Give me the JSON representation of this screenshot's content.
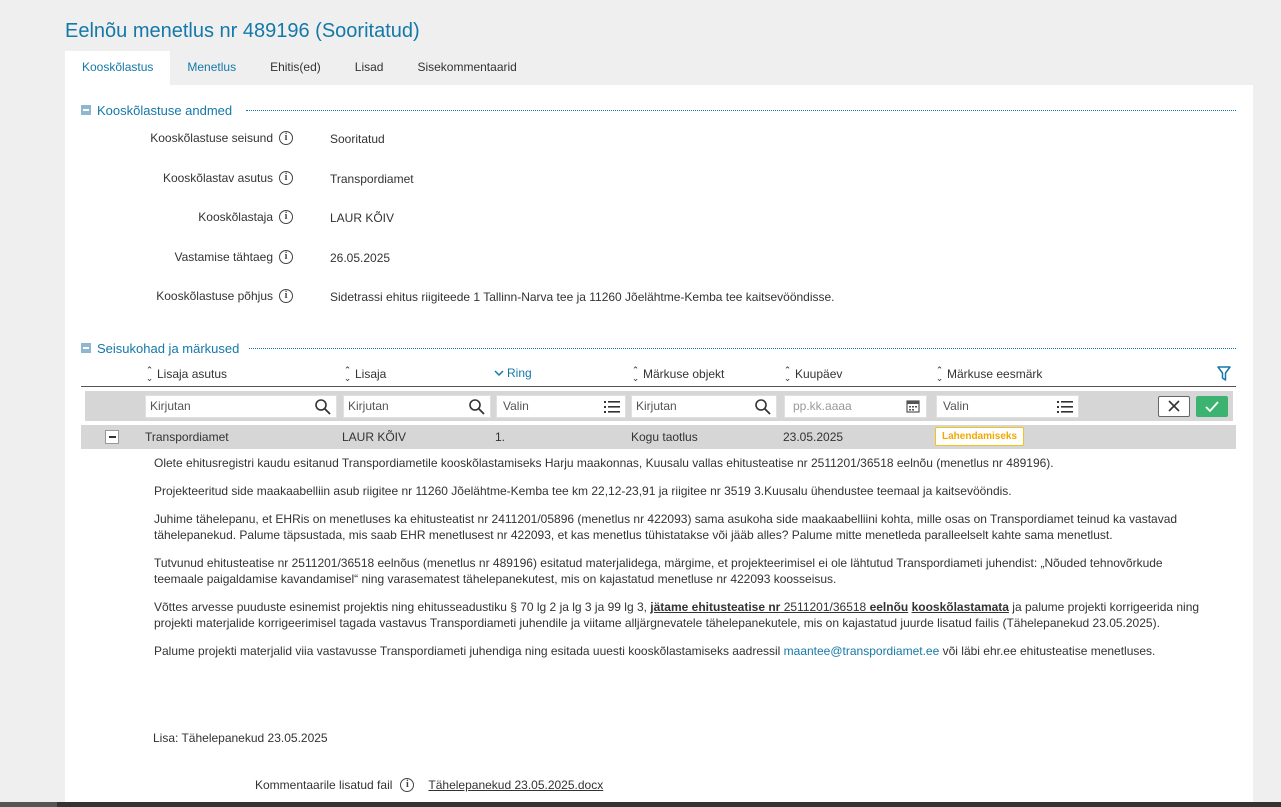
{
  "title": "Eelnõu menetlus nr 489196 (Sooritatud)",
  "tabs": [
    "Kooskõlastus",
    "Menetlus",
    "Ehitis(ed)",
    "Lisad",
    "Sisekommentaarid"
  ],
  "section1": {
    "title": "Kooskõlastuse andmed",
    "fields": [
      {
        "label": "Kooskõlastuse seisund",
        "value": "Sooritatud"
      },
      {
        "label": "Kooskõlastav asutus",
        "value": "Transpordiamet"
      },
      {
        "label": "Kooskõlastaja",
        "value": "LAUR KÕIV"
      },
      {
        "label": "Vastamise tähtaeg",
        "value": "26.05.2025"
      },
      {
        "label": "Kooskõlastuse põhjus",
        "value": "Sidetrassi ehitus riigiteede 1 Tallinn-Narva tee ja 11260 Jõelähtme-Kemba tee kaitsevööndisse."
      }
    ]
  },
  "section2": {
    "title": "Seisukohad ja märkused",
    "columns": [
      "Lisaja asutus",
      "Lisaja",
      "Ring",
      "Märkuse objekt",
      "Kuupäev",
      "Märkuse eesmärk"
    ],
    "filters": {
      "asutus": "Kirjutan",
      "lisaja": "Kirjutan",
      "ring": "Valin",
      "objekt": "Kirjutan",
      "kuupaev": "pp.kk.aaaa",
      "eesmark": "Valin"
    },
    "row": {
      "asutus": "Transpordiamet",
      "lisaja": "LAUR KÕIV",
      "ring": "1.",
      "objekt": "Kogu taotlus",
      "kuupaev": "23.05.2025",
      "eesmark": "Lahendamiseks"
    },
    "paragraphs": {
      "p1": "Olete ehitusregistri kaudu esitanud Transpordiametile kooskõlastamiseks Harju maakonnas, Kuusalu vallas ehitusteatise nr 2511201/36518 eelnõu (menetlus nr 489196).",
      "p2": "Projekteeritud side maakaabelliin asub riigitee nr 11260 Jõelähtme-Kemba tee km 22,12-23,91 ja riigitee nr 3519 3.Kuusalu ühendustee teemaal ja kaitsevööndis.",
      "p3": "Juhime tähelepanu, et EHRis on menetluses ka ehitusteatist nr 2411201/05896 (menetlus nr 422093) sama asukoha side maakaabelliini kohta, mille osas on Transpordiamet teinud ka vastavad tähelepanekud. Palume täpsustada, mis saab EHR menetlusest nr 422093, et kas menetlus tühistatakse või jääb alles? Palume mitte menetleda paralleelselt kahte sama menetlust.",
      "p4": "Tutvunud ehitusteatise nr 2511201/36518 eelnõus (menetlus nr 489196) esitatud materjalidega, märgime, et projekteerimisel ei ole lähtutud Transpordiameti juhendist: „Nõuded tehnovõrkude teemaale paigaldamise kavandamisel“ ning varasematest tähelepanekutest, mis on kajastatud menetluse nr 422093 koosseisus.",
      "p5a": "Võttes arvesse puuduste esinemist projektis ning ehitusseadustiku § 70 lg 2 ja lg 3 ja 99 lg 3, ",
      "p5b1": "jätame ehitusteatise nr",
      "p5b2": " 2511201/36518 ",
      "p5b3": "eelnõu",
      "p5b4": " ",
      "p5b5": "kooskõlastamata",
      "p5c": " ja palume projekti korrigeerida ning projekti materjalide korrigeerimisel tagada vastavus Transpordiameti juhendile ja viitame alljärgnevatele tähelepanekutele, mis on kajastatud juurde lisatud failis (Tähelepanekud 23.05.2025).",
      "p6a": "Palume projekti materjalid viia vastavusse Transpordiameti juhendiga ning esitada uuesti kooskõlastamiseks aadressil ",
      "p6email": "maantee@transpordiamet.ee",
      "p6b": " või läbi ehr.ee ehitusteatise menetluses."
    },
    "lisa": "Lisa: Tähelepanekud 23.05.2025",
    "attachment_label": "Kommentaarile lisatud fail",
    "attachment_file": "Tähelepanekud 23.05.2025.docx"
  },
  "colors": {
    "accent": "#1478a8",
    "badge": "#f0c419",
    "ok": "#3cb371"
  }
}
